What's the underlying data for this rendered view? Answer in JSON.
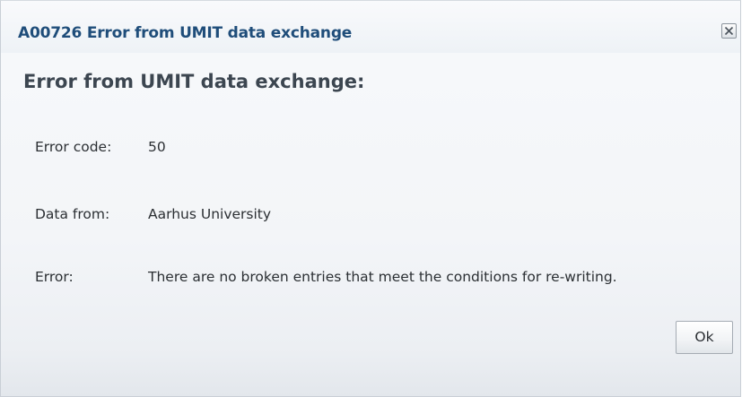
{
  "dialog": {
    "title": "A00726 Error from UMIT data exchange",
    "close_icon": "close-icon",
    "heading": "Error from UMIT data exchange:",
    "fields": {
      "code": {
        "label": "Error code:",
        "value": "50"
      },
      "data_from": {
        "label": "Data from:",
        "value": "Aarhus University"
      },
      "error": {
        "label": "Error:",
        "value": "There are no broken entries that meet the conditions for re-writing."
      }
    },
    "ok_label": "Ok"
  },
  "colors": {
    "title": "#1f4d7a",
    "heading": "#3c4650",
    "text": "#2b2f33"
  }
}
